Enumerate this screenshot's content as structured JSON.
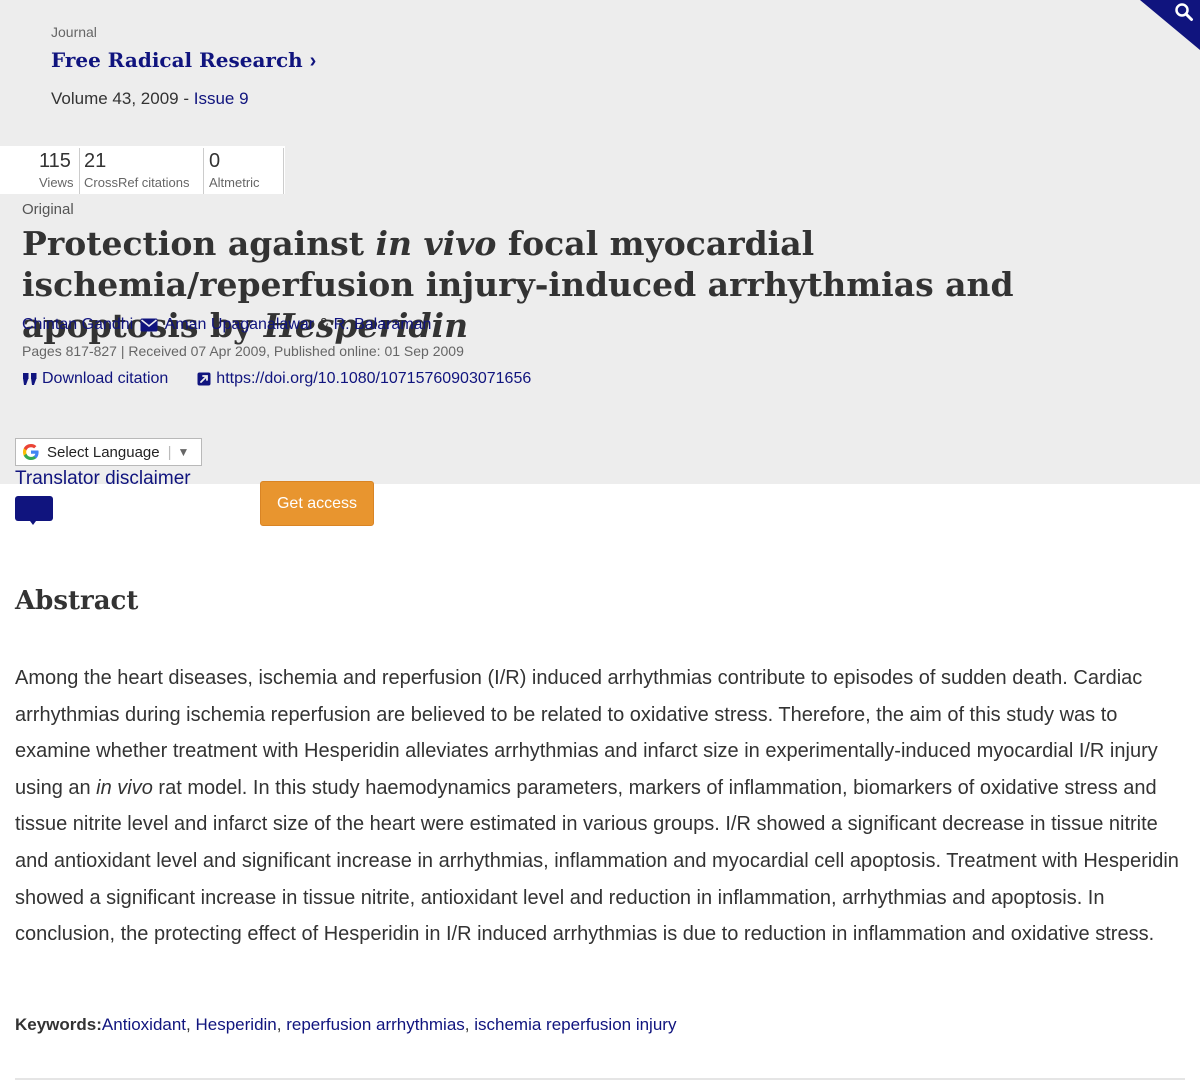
{
  "journal": {
    "label": "Journal",
    "name": "Free Radical Research",
    "chevron": "›",
    "volume_text": "Volume 43, 2009 - ",
    "issue_link": "Issue 9"
  },
  "metrics": [
    {
      "value": "115",
      "label": "Views"
    },
    {
      "value": "21",
      "label": "CrossRef citations"
    },
    {
      "value": "0",
      "label": "Altmetric"
    }
  ],
  "article": {
    "type": "Original",
    "title_part1": "Protection against ",
    "title_italic1": "in vivo",
    "title_part2": " focal myocardial ischemia/reperfusion injury-induced arrhythmias and apoptosis by ",
    "title_italic2": "Hesperidin",
    "authors": {
      "author1": "Chintan Gandhi",
      "sep1": ", ",
      "author2": "Aman Upaganalawar",
      "sep2": " & ",
      "author3": "R. Balaraman"
    },
    "pubinfo": "Pages 817-827 | Received 07 Apr 2009, Published online: 01 Sep 2009",
    "download_citation": "Download citation",
    "doi": "https://doi.org/10.1080/10715760903071656"
  },
  "translate": {
    "select_label": "Select Language",
    "disclaimer": "Translator disclaimer"
  },
  "get_access": "Get access",
  "abstract": {
    "heading": "Abstract",
    "text_part1": "Among the heart diseases, ischemia and reperfusion (I/R) induced arrhythmias contribute to episodes of sudden death. Cardiac arrhythmias during ischemia reperfusion are believed to be related to oxidative stress. Therefore, the aim of this study was to examine whether treatment with Hesperidin alleviates arrhythmias and infarct size in experimentally-induced myocardial I/R injury using an ",
    "text_italic": "in vivo",
    "text_part2": " rat model. In this study haemodynamics parameters, markers of inflammation, biomarkers of oxidative stress and tissue nitrite level and infarct size of the heart were estimated in various groups. I/R showed a significant decrease in tissue nitrite and antioxidant level and significant increase in arrhythmias, inflammation and myocardial cell apoptosis. Treatment with Hesperidin showed a significant increase in tissue nitrite, antioxidant level and reduction in inflammation, arrhythmias and apoptosis. In conclusion, the protecting effect of Hesperidin in I/R induced arrhythmias is due to reduction in inflammation and oxidative stress."
  },
  "keywords": {
    "label": "Keywords:",
    "items": [
      "Antioxidant",
      "Hesperidin",
      "reperfusion arrhythmias",
      "ischemia reperfusion injury"
    ],
    "separator": ", "
  },
  "colors": {
    "link": "#10147e",
    "band": "#ededed",
    "access_button": "#e8952f"
  },
  "icons": [
    "search-icon",
    "envelope-icon",
    "quote-icon",
    "external-link-icon",
    "google-g-icon",
    "dropdown-arrow-icon",
    "comment-icon"
  ]
}
